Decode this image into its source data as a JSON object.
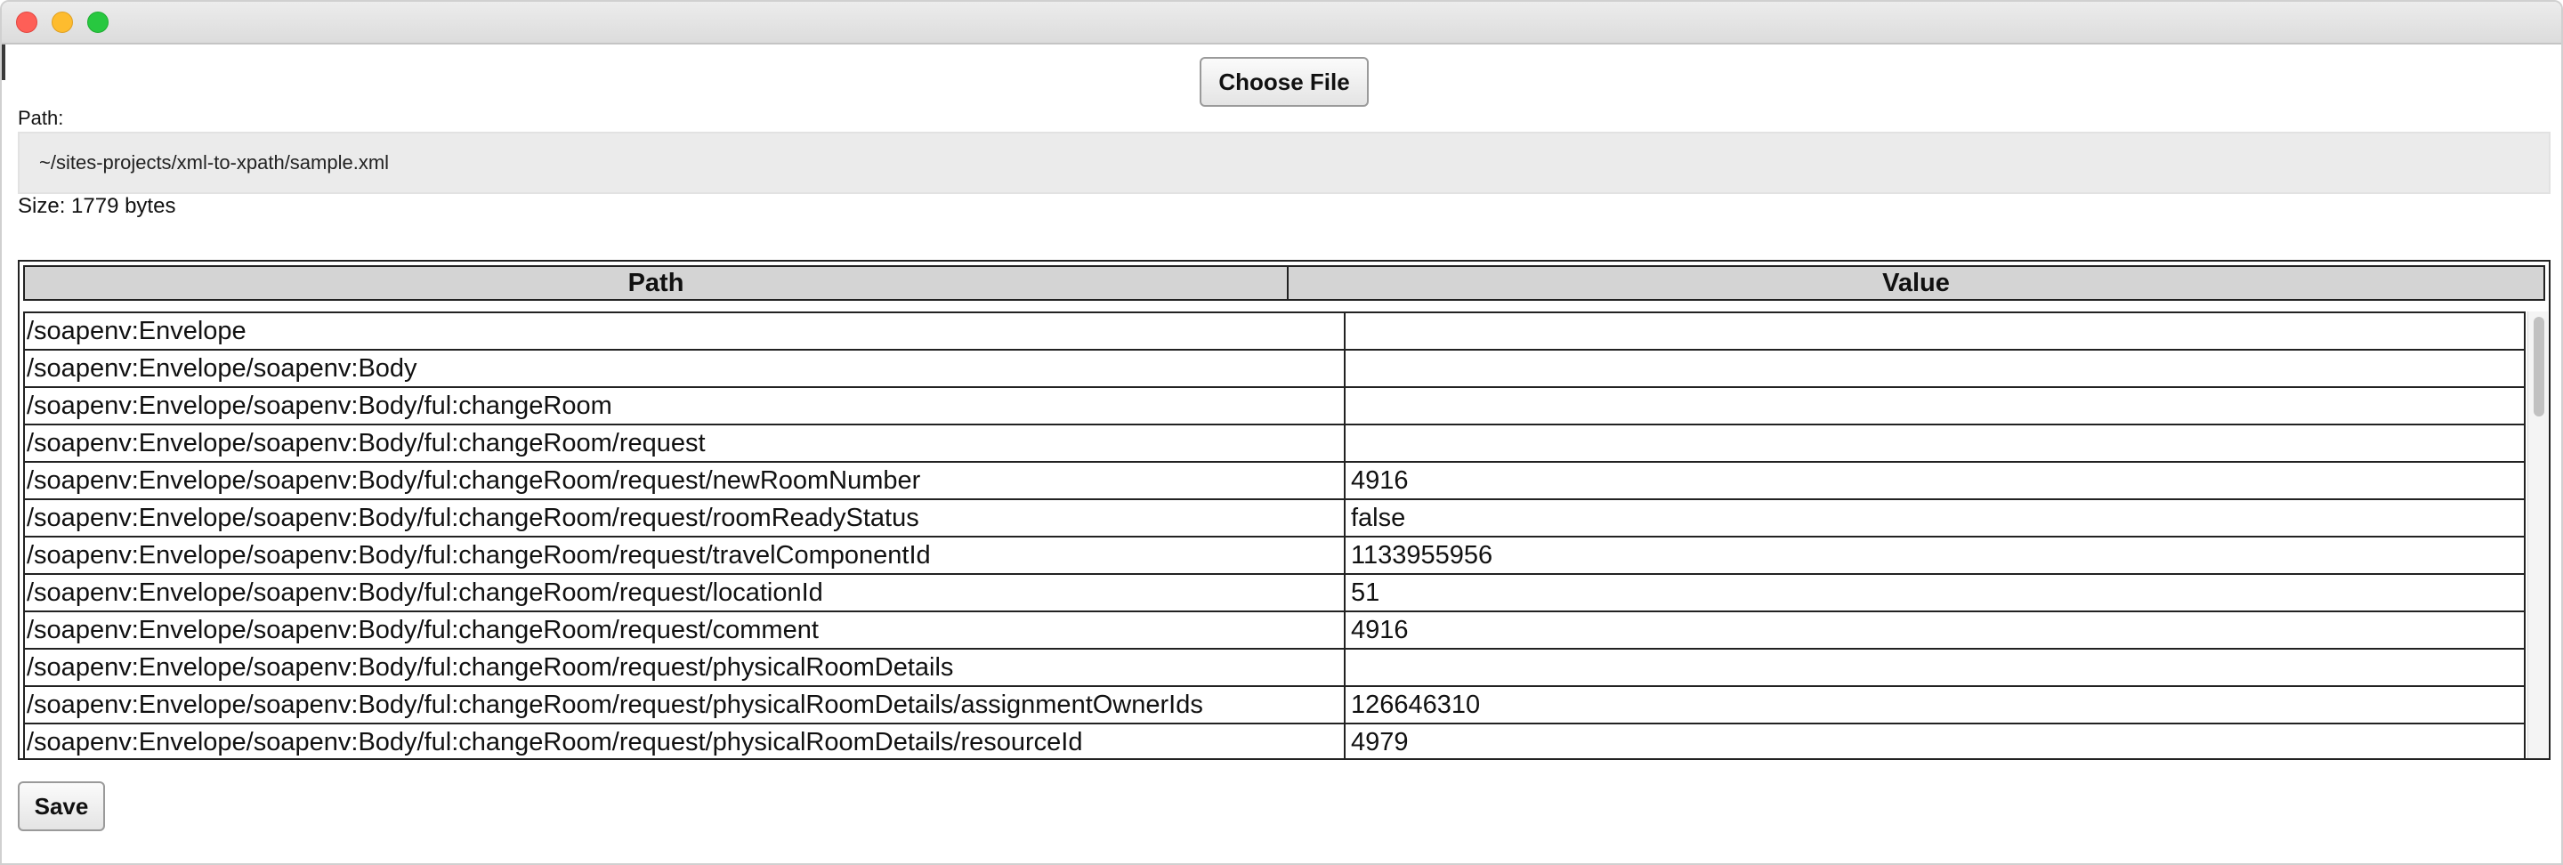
{
  "window": {
    "controls": {
      "close": "close-icon",
      "minimize": "minimize-icon",
      "maximize": "maximize-icon"
    }
  },
  "toolbar": {
    "choose_file_label": "Choose File"
  },
  "file": {
    "path_label": "Path:",
    "path_value": "~/sites-projects/xml-to-xpath/sample.xml",
    "size_text": "Size: 1779 bytes"
  },
  "table": {
    "headers": {
      "path": "Path",
      "value": "Value"
    },
    "rows": [
      {
        "path": "/soapenv:Envelope",
        "value": ""
      },
      {
        "path": "/soapenv:Envelope/soapenv:Body",
        "value": ""
      },
      {
        "path": "/soapenv:Envelope/soapenv:Body/ful:changeRoom",
        "value": ""
      },
      {
        "path": "/soapenv:Envelope/soapenv:Body/ful:changeRoom/request",
        "value": ""
      },
      {
        "path": "/soapenv:Envelope/soapenv:Body/ful:changeRoom/request/newRoomNumber",
        "value": "4916"
      },
      {
        "path": "/soapenv:Envelope/soapenv:Body/ful:changeRoom/request/roomReadyStatus",
        "value": "false"
      },
      {
        "path": "/soapenv:Envelope/soapenv:Body/ful:changeRoom/request/travelComponentId",
        "value": "1133955956"
      },
      {
        "path": "/soapenv:Envelope/soapenv:Body/ful:changeRoom/request/locationId",
        "value": "51"
      },
      {
        "path": "/soapenv:Envelope/soapenv:Body/ful:changeRoom/request/comment",
        "value": "4916"
      },
      {
        "path": "/soapenv:Envelope/soapenv:Body/ful:changeRoom/request/physicalRoomDetails",
        "value": ""
      },
      {
        "path": "/soapenv:Envelope/soapenv:Body/ful:changeRoom/request/physicalRoomDetails/assignmentOwnerIds",
        "value": "126646310"
      },
      {
        "path": "/soapenv:Envelope/soapenv:Body/ful:changeRoom/request/physicalRoomDetails/resourceId",
        "value": "4979"
      }
    ]
  },
  "footer": {
    "save_label": "Save"
  },
  "colors": {
    "close": "#fe5f57",
    "minimize": "#febc2e",
    "maximize": "#28c840",
    "header_bg": "#d4d4d4",
    "input_bg": "#ebebeb"
  }
}
